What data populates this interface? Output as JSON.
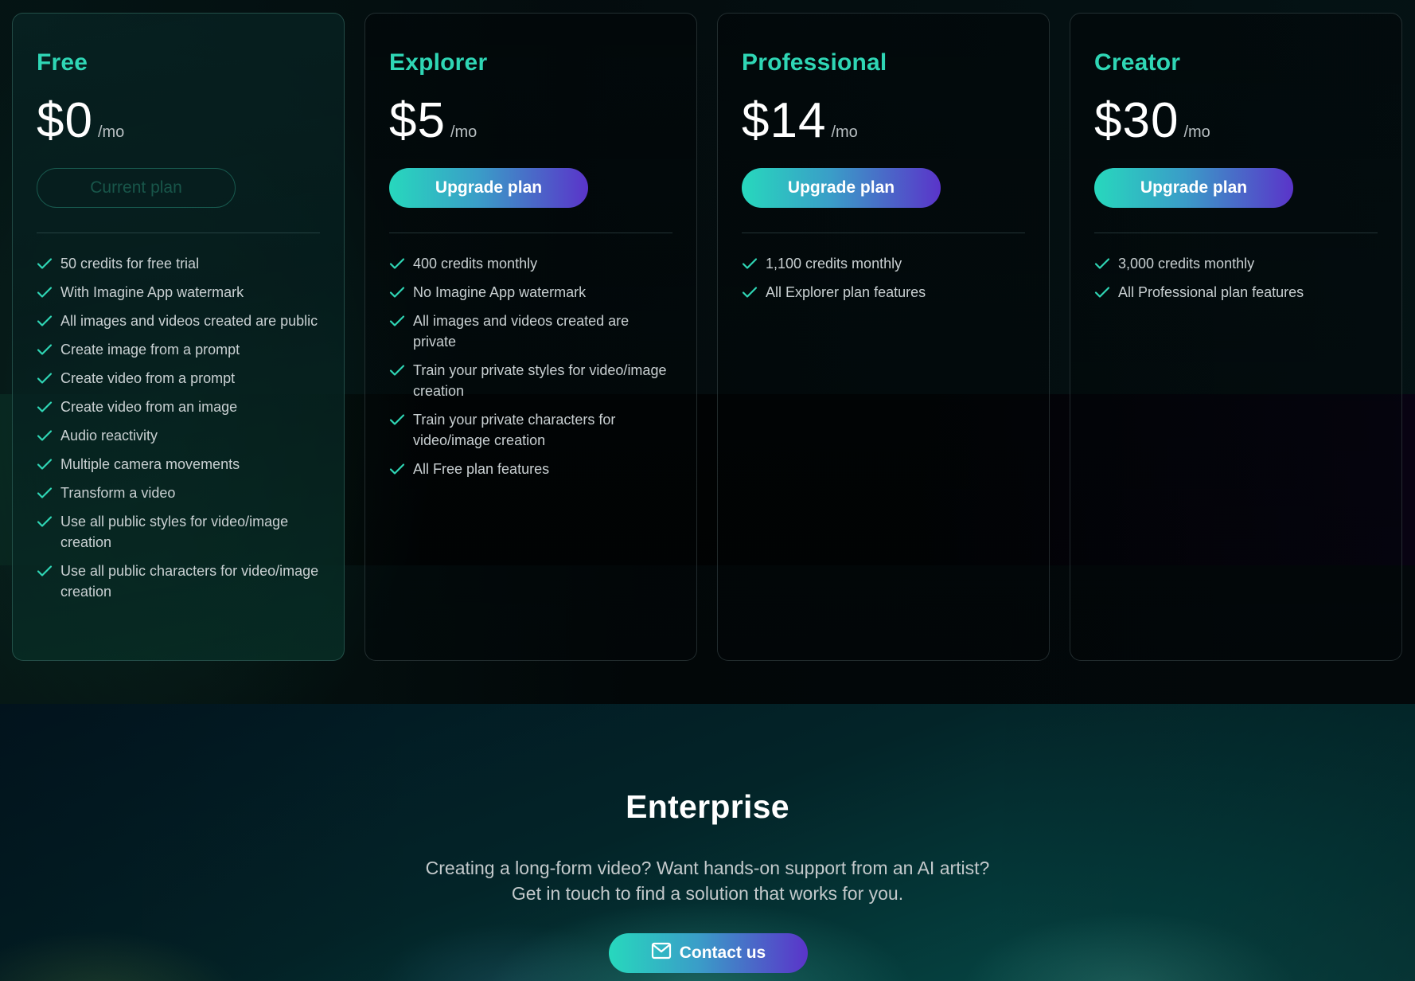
{
  "colors": {
    "accent": "#2fd6b5",
    "gradient_start": "#27d8bd",
    "gradient_end": "#5a34c9"
  },
  "plans": [
    {
      "name": "Free",
      "price": "$0",
      "period": "/mo",
      "button_label": "Current plan",
      "button_state": "current",
      "features": [
        "50 credits for free trial",
        "With Imagine App watermark",
        "All images and videos created are public",
        "Create image from a prompt",
        "Create video from a prompt",
        "Create video from an image",
        "Audio reactivity",
        "Multiple camera movements",
        "Transform a video",
        "Use all public styles for video/image creation",
        "Use all public characters for video/image creation"
      ]
    },
    {
      "name": "Explorer",
      "price": "$5",
      "period": "/mo",
      "button_label": "Upgrade plan",
      "button_state": "upgrade",
      "features": [
        "400 credits monthly",
        "No Imagine App watermark",
        "All images and videos created are private",
        "Train your private styles for video/image creation",
        "Train your private characters for video/image creation",
        "All Free plan features"
      ]
    },
    {
      "name": "Professional",
      "price": "$14",
      "period": "/mo",
      "button_label": "Upgrade plan",
      "button_state": "upgrade",
      "features": [
        "1,100 credits monthly",
        "All Explorer plan features"
      ]
    },
    {
      "name": "Creator",
      "price": "$30",
      "period": "/mo",
      "button_label": "Upgrade plan",
      "button_state": "upgrade",
      "features": [
        "3,000 credits monthly",
        "All Professional plan features"
      ]
    }
  ],
  "enterprise": {
    "title": "Enterprise",
    "description_lines": [
      "Creating a long-form video? Want hands-on support from an AI artist?",
      "Get in touch to find a solution that works for you."
    ],
    "contact_label": "Contact us",
    "contact_icon": "mail-icon"
  }
}
